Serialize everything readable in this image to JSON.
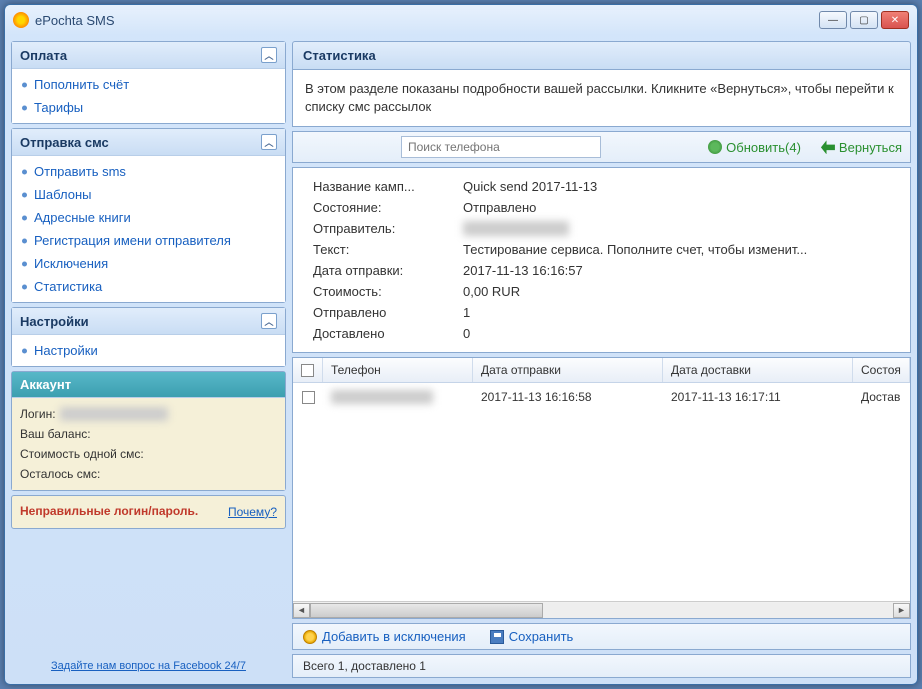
{
  "window": {
    "title": "ePochta SMS"
  },
  "sidebar": {
    "sections": [
      {
        "title": "Оплата",
        "items": [
          "Пополнить счёт",
          "Тарифы"
        ]
      },
      {
        "title": "Отправка смс",
        "items": [
          "Отправить sms",
          "Шаблоны",
          "Адресные книги",
          "Регистрация имени отправителя",
          "Исключения",
          "Статистика"
        ],
        "active": 5
      },
      {
        "title": "Настройки",
        "items": [
          "Настройки"
        ]
      }
    ],
    "account": {
      "title": "Аккаунт",
      "login_label": "Логин:",
      "balance_label": "Ваш баланс:",
      "cost_label": "Стоимость одной смс:",
      "remaining_label": "Осталось смс:"
    },
    "error": {
      "text": "Неправильные логин/пароль.",
      "why": "Почему?"
    },
    "fb_link": "Задайте нам вопрос на Facebook 24/7"
  },
  "main": {
    "title": "Статистика",
    "description": "В этом разделе показаны подробности вашей рассылки. Кликните «Вернуться», чтобы перейти к списку смс рассылок",
    "toolbar": {
      "search_placeholder": "Поиск телефона",
      "refresh": "Обновить(4)",
      "back": "Вернуться"
    },
    "details": [
      {
        "label": "Название камп...",
        "value": "Quick send 2017-11-13"
      },
      {
        "label": "Состояние:",
        "value": "Отправлено"
      },
      {
        "label": "Отправитель:",
        "value": "",
        "blurred": true
      },
      {
        "label": "Текст:",
        "value": "Тестирование сервиса. Пополните счет, чтобы изменит..."
      },
      {
        "label": "Дата отправки:",
        "value": "2017-11-13 16:16:57"
      },
      {
        "label": "Стоимость:",
        "value": "0,00 RUR"
      },
      {
        "label": "Отправлено",
        "value": "1"
      },
      {
        "label": "Доставлено",
        "value": "0"
      }
    ],
    "table": {
      "columns": [
        "Телефон",
        "Дата отправки",
        "Дата доставки",
        "Состоя"
      ],
      "rows": [
        {
          "phone_blurred": true,
          "sent": "2017-11-13 16:16:58",
          "delivered": "2017-11-13 16:17:11",
          "state": "Достав"
        }
      ]
    },
    "bottom": {
      "exclude": "Добавить в исключения",
      "save": "Сохранить"
    },
    "status": "Всего 1, доставлено 1"
  }
}
